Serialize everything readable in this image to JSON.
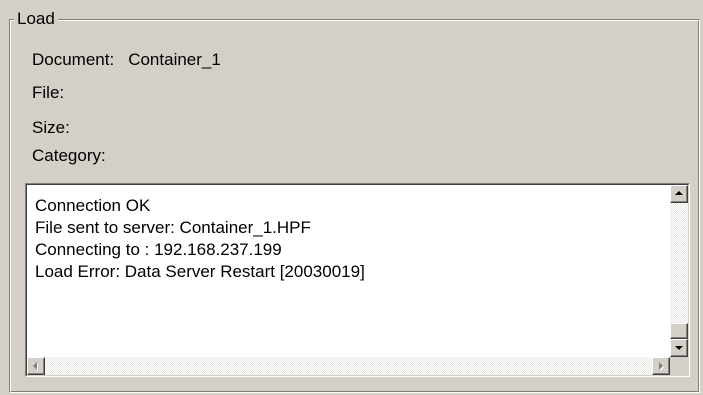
{
  "group": {
    "title": "Load"
  },
  "info": {
    "document_label": "Document:",
    "document_value": "Container_1",
    "file_label": "File:",
    "size_label": "Size:",
    "category_label": "Category:"
  },
  "log": {
    "lines": [
      "Connection OK",
      "File sent to server: Container_1.HPF",
      "Connecting to : 192.168.237.199",
      "Load Error: Data Server Restart [20030019]"
    ],
    "vertical_scroll_position": 1.0
  },
  "icons": {
    "scroll_up": "up-arrow-icon",
    "scroll_down": "down-arrow-icon",
    "scroll_left": "left-arrow-icon",
    "scroll_right": "right-arrow-icon"
  }
}
